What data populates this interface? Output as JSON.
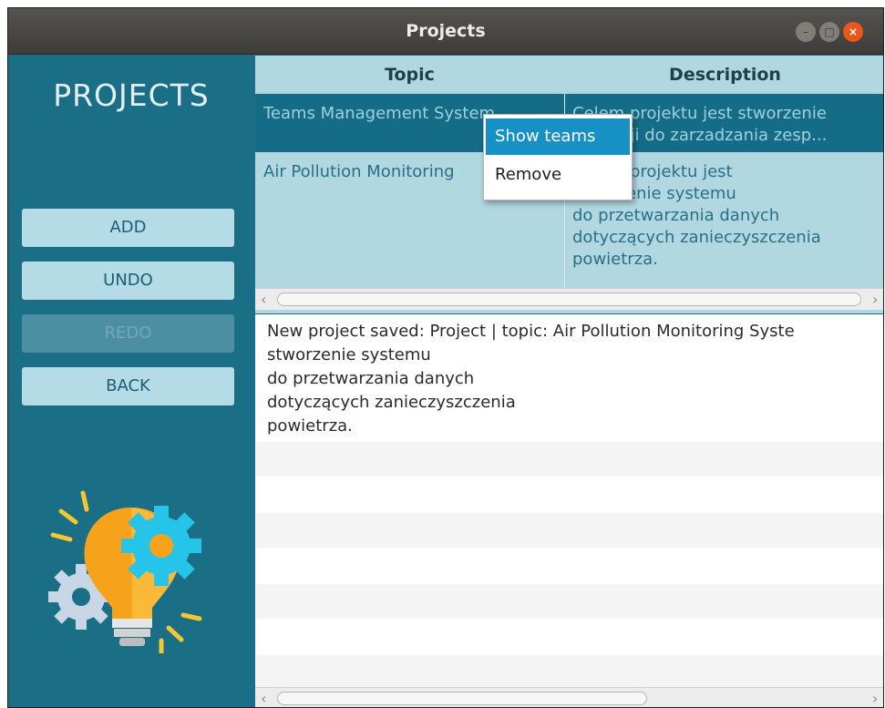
{
  "window": {
    "title": "Projects",
    "controls": {
      "minimize": "–",
      "maximize": "□",
      "close": "×"
    }
  },
  "sidebar": {
    "title": "PROJECTS",
    "buttons": [
      {
        "label": "ADD",
        "enabled": true
      },
      {
        "label": "UNDO",
        "enabled": true
      },
      {
        "label": "REDO",
        "enabled": false
      },
      {
        "label": "BACK",
        "enabled": true
      }
    ],
    "illustration": "lightbulb-gears-icon"
  },
  "table": {
    "columns": [
      "Topic",
      "Description"
    ],
    "rows": [
      {
        "topic": "Teams Management System",
        "description": "Celem projektu jest stworzenie\naplikacji do zarzadzania zesp...",
        "selected": true
      },
      {
        "topic": "Air Pollution Monitoring",
        "description": "Celem projektu jest\nstworzenie systemu\ndo przetwarzania danych\ndotyczących zanieczyszczenia\npowietrza.",
        "selected": false
      }
    ]
  },
  "context_menu": {
    "items": [
      {
        "label": "Show teams",
        "highlighted": true
      },
      {
        "label": "Remove",
        "highlighted": false
      }
    ]
  },
  "log": {
    "text": "New project saved: Project | topic: Air Pollution Monitoring Syste\nstworzenie systemu\ndo przetwarzania danych\ndotyczących zanieczyszczenia\npowietrza."
  },
  "colors": {
    "sidebar_bg": "#1a6f86",
    "button_bg": "#b5dbe6",
    "selected_row": "#156c86",
    "menu_highlight": "#1790c5"
  }
}
